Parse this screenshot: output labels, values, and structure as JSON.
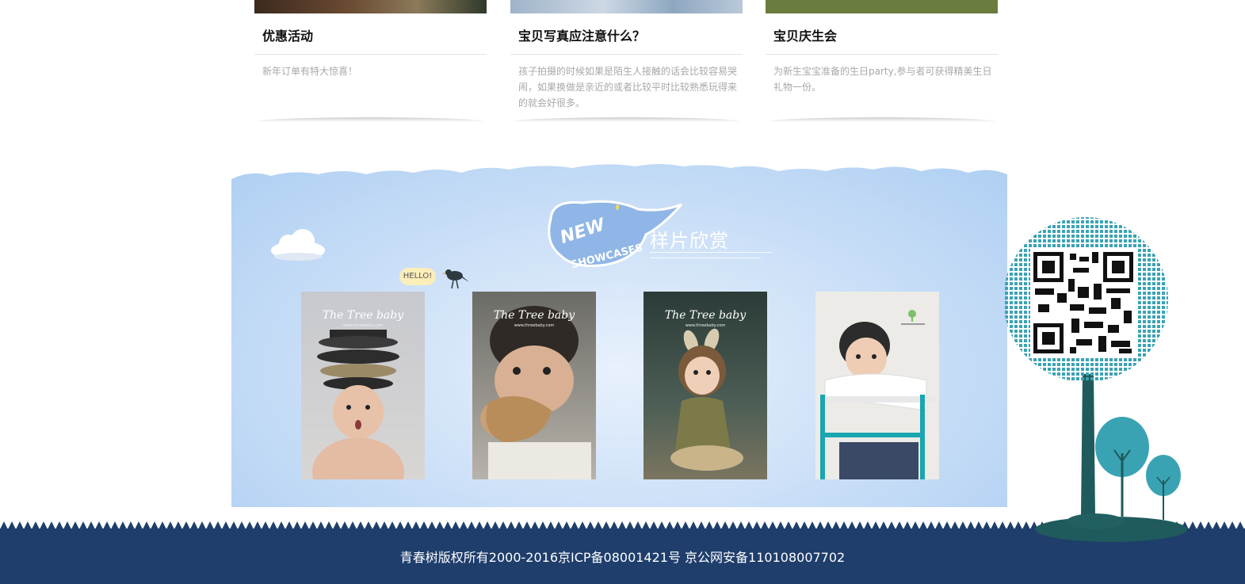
{
  "cards": [
    {
      "title": "优惠活动",
      "desc": "新年订单有特大惊喜！"
    },
    {
      "title": "宝贝写真应注意什么？",
      "desc": "孩子拍摄的时候如果是陌生人接触的话会比较容易哭闹，如果换做是亲近的或者比较平时比较熟悉玩得来的就会好很多。"
    },
    {
      "title": "宝贝庆生会",
      "desc": "为新生宝宝准备的生日party,参与者可获得精美生日礼物一份。"
    }
  ],
  "showcase": {
    "logo_line1": "NEW",
    "logo_line2": "SHOWCASES",
    "title": "样片欣赏",
    "hello": "HELLO!",
    "photos": [
      {
        "watermark": "The Tree baby",
        "sub": "www.threebaby.com"
      },
      {
        "watermark": "The Tree baby",
        "sub": "www.threebaby.com"
      },
      {
        "watermark": "The Tree baby",
        "sub": "www.threebaby.com"
      },
      {
        "watermark": "",
        "sub": ""
      }
    ]
  },
  "footer": {
    "copyright": "青春树版权所有2000-2016京ICP备08001421号  京公网安备110108007702"
  },
  "colors": {
    "footer_bg": "#1f3e6c",
    "showcase_bg": "#c9def7",
    "qr_teal": "#3aa3b3",
    "trunk": "#1f5a5c"
  }
}
